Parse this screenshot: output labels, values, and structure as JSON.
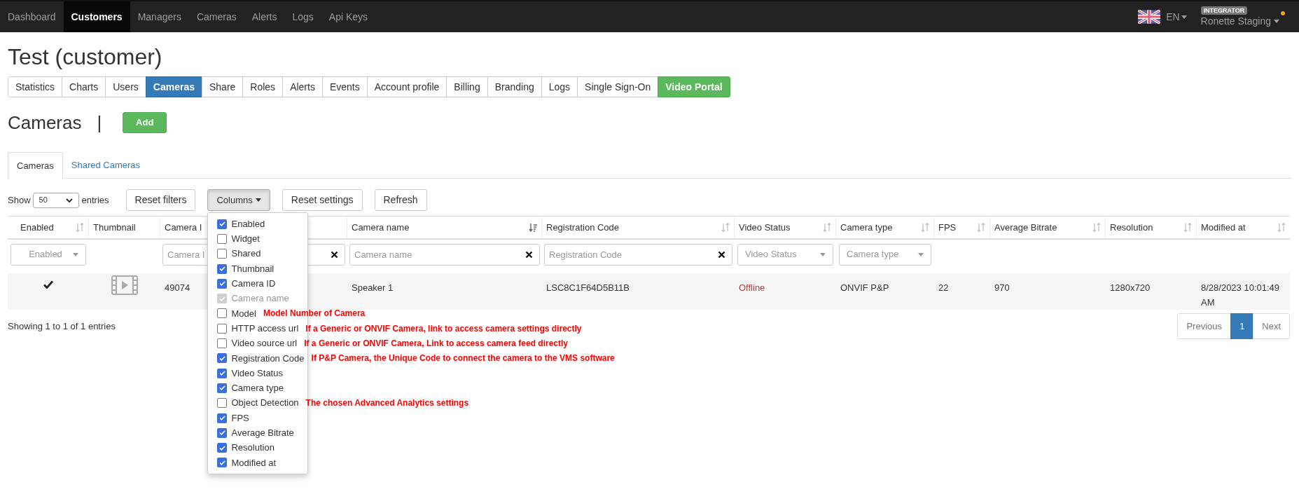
{
  "navbar": {
    "items": [
      {
        "label": "Dashboard",
        "selected": false
      },
      {
        "label": "Customers",
        "selected": true
      },
      {
        "label": "Managers",
        "selected": false
      },
      {
        "label": "Cameras",
        "selected": false
      },
      {
        "label": "Alerts",
        "selected": false
      },
      {
        "label": "Logs",
        "selected": false
      },
      {
        "label": "Api Keys",
        "selected": false
      }
    ],
    "language": "EN",
    "role_badge": "INTEGRATOR",
    "user": "Ronette Staging"
  },
  "page_title": "Test (customer)",
  "customer_tabs": [
    {
      "label": "Statistics",
      "selected": false,
      "kind": "normal"
    },
    {
      "label": "Charts",
      "selected": false,
      "kind": "normal"
    },
    {
      "label": "Users",
      "selected": false,
      "kind": "normal"
    },
    {
      "label": "Cameras",
      "selected": true,
      "kind": "normal"
    },
    {
      "label": "Share",
      "selected": false,
      "kind": "normal"
    },
    {
      "label": "Roles",
      "selected": false,
      "kind": "normal"
    },
    {
      "label": "Alerts",
      "selected": false,
      "kind": "normal"
    },
    {
      "label": "Events",
      "selected": false,
      "kind": "normal"
    },
    {
      "label": "Account profile",
      "selected": false,
      "kind": "normal"
    },
    {
      "label": "Billing",
      "selected": false,
      "kind": "normal"
    },
    {
      "label": "Branding",
      "selected": false,
      "kind": "normal"
    },
    {
      "label": "Logs",
      "selected": false,
      "kind": "normal"
    },
    {
      "label": "Single Sign-On",
      "selected": false,
      "kind": "normal"
    },
    {
      "label": "Video Portal",
      "selected": false,
      "kind": "highlight"
    }
  ],
  "section": {
    "title": "Cameras",
    "separator": "|",
    "add_button": "Add"
  },
  "sub_tabs": [
    {
      "label": "Cameras",
      "selected": true
    },
    {
      "label": "Shared Cameras",
      "selected": false
    }
  ],
  "toolbar": {
    "show_label": "Show",
    "page_size": "50",
    "entries_label": "entries",
    "buttons": [
      "Reset filters",
      "Columns",
      "Reset settings",
      "Refresh"
    ]
  },
  "columns_menu": [
    {
      "label": "Enabled",
      "checked": true,
      "disabled": false
    },
    {
      "label": "Widget",
      "checked": false,
      "disabled": false
    },
    {
      "label": "Shared",
      "checked": false,
      "disabled": false
    },
    {
      "label": "Thumbnail",
      "checked": true,
      "disabled": false
    },
    {
      "label": "Camera ID",
      "checked": true,
      "disabled": false
    },
    {
      "label": "Camera name",
      "checked": true,
      "disabled": true
    },
    {
      "label": "Model",
      "checked": false,
      "disabled": false,
      "annotation": "Model Number of Camera"
    },
    {
      "label": "HTTP access url",
      "checked": false,
      "disabled": false,
      "annotation": "If a Generic or ONVIF Camera, link to access camera settings directly"
    },
    {
      "label": "Video source url",
      "checked": false,
      "disabled": false,
      "annotation": "If a Generic or ONVIF Camera, Link to access camera feed directly"
    },
    {
      "label": "Registration Code",
      "checked": true,
      "disabled": false,
      "annotation": "If P&P Camera, the Unique Code to connect the camera to the VMS software"
    },
    {
      "label": "Video Status",
      "checked": true,
      "disabled": false
    },
    {
      "label": "Camera type",
      "checked": true,
      "disabled": false
    },
    {
      "label": "Object Detection",
      "checked": false,
      "disabled": false,
      "annotation": "The chosen Advanced Analytics settings"
    },
    {
      "label": "FPS",
      "checked": true,
      "disabled": false
    },
    {
      "label": "Average Bitrate",
      "checked": true,
      "disabled": false
    },
    {
      "label": "Resolution",
      "checked": true,
      "disabled": false
    },
    {
      "label": "Modified at",
      "checked": true,
      "disabled": false
    }
  ],
  "table": {
    "columns": [
      {
        "label": "Enabled",
        "sortable": true,
        "sorted": false,
        "filter": {
          "kind": "select",
          "placeholder": "Enabled"
        }
      },
      {
        "label": "Thumbnail",
        "filter": {
          "kind": "none"
        }
      },
      {
        "label": "Camera I",
        "filter": {
          "kind": "text",
          "placeholder": "Camera I"
        }
      },
      {
        "label": "Camera name",
        "sortable": true,
        "sorted": true,
        "filter": {
          "kind": "text",
          "placeholder": "Camera name"
        }
      },
      {
        "label": "Registration Code",
        "sortable": true,
        "sorted": false,
        "filter": {
          "kind": "text",
          "placeholder": "Registration Code"
        }
      },
      {
        "label": "Video Status",
        "sortable": true,
        "sorted": false,
        "filter": {
          "kind": "select",
          "placeholder": "Video Status"
        }
      },
      {
        "label": "Camera type",
        "sortable": true,
        "sorted": false,
        "filter": {
          "kind": "select",
          "placeholder": "Camera type"
        }
      },
      {
        "label": "FPS",
        "sortable": true,
        "sorted": false,
        "filter": {
          "kind": "none"
        }
      },
      {
        "label": "Average Bitrate",
        "sortable": true,
        "sorted": false,
        "filter": {
          "kind": "none"
        }
      },
      {
        "label": "Resolution",
        "sortable": true,
        "sorted": false,
        "filter": {
          "kind": "none"
        }
      },
      {
        "label": "Modified at",
        "sortable": true,
        "sorted": false,
        "filter": {
          "kind": "none"
        }
      }
    ],
    "rows": [
      {
        "cells": [
          {
            "kind": "check",
            "checked": true
          },
          {
            "kind": "thumbnail"
          },
          {
            "kind": "text",
            "text": "49074"
          },
          {
            "kind": "text",
            "text": "Speaker 1"
          },
          {
            "kind": "text",
            "text": "LSC8C1F64D5B11B"
          },
          {
            "kind": "status",
            "text": "Offline"
          },
          {
            "kind": "text",
            "text": "ONVIF P&P"
          },
          {
            "kind": "text",
            "text": "22"
          },
          {
            "kind": "text",
            "text": "970"
          },
          {
            "kind": "text",
            "text": "1280x720"
          },
          {
            "kind": "text",
            "text": "8/28/2023 10:01:49 AM"
          }
        ]
      }
    ]
  },
  "footer": {
    "info": "Showing 1 to 1 of 1 entries",
    "pagination": [
      {
        "label": "Previous",
        "selected": false
      },
      {
        "label": "1",
        "selected": true
      },
      {
        "label": "Next",
        "selected": false
      }
    ]
  }
}
